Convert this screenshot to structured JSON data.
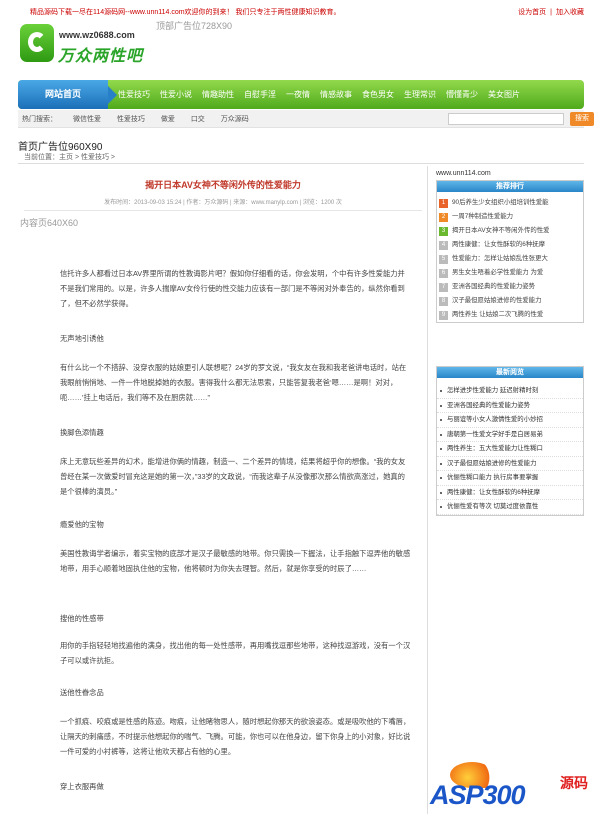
{
  "topbar": {
    "promo": "精品源码下载一尽在114源码网--www.unn114.com欢迎你的到来！ 我们只专注于两性健康知识教育。",
    "set_home": "设为首页",
    "add_favorite": "加入收藏"
  },
  "header_ad": "顶部广告位728X90",
  "logo": {
    "url": "www.wz0688.com",
    "name": "万众两性吧"
  },
  "nav": {
    "home": "网站首页",
    "items": [
      "性爱技巧",
      "性爱小说",
      "情趣助性",
      "自慰手淫",
      "一夜情",
      "情感故事",
      "食色男女",
      "生理常识",
      "懵懂青少",
      "美女图片"
    ]
  },
  "hotbar": {
    "label": "热门搜索：",
    "keywords": [
      "微信性爱",
      "性爱技巧",
      "做爱",
      "口交",
      "万众源码"
    ],
    "search_button": "搜索"
  },
  "banner_ad": "首页广告位960X90",
  "breadcrumb": "当前位置：主页 > 性爱技巧 >",
  "article": {
    "title": "揭开日本AV女神不等闲外传的性爱能力",
    "meta": "发布时间：2013-09-03 15:24 | 作者：万众源码 | 来源：www.manylp.com | 浏览：1200 次",
    "content_ad": "内容页640X60",
    "p1": "信托许多人都看过日本AV界里所谓的性教诲影片吧？假如你仔细看的话，你会发明，个中有许多性爱能力并不是我们常用的。以是，许多人揣摩AV女伶行使的性交能力应该有一部门是不等闲对外奉告的，纵然你看到了，但不必然学获得。",
    "s1": "无声地引诱他",
    "p2": "有什么比一个不措辞、没穿衣服的姑娘更引人联想呢？24岁的罗文说，“我女友在我和我老爸讲电话时，站在我眼前悄悄地、一件一件地脱掉她的衣服。害得我什么都无法思索，只能答复我老爸‘嗯……是啊！对对，呃……’挂上电话后，我们等不及在厨房就……”",
    "s2": "换脚色添情趣",
    "p3": "床上无意玩些差异的幻术，能增进你俩的情趣，制造一、二个差异的情境，结果将超乎你的想像。“我的女友曾经在某一次做爱时冒充这是她的第一次，”33岁的文政说，“而我这辈子从没像那次那么情欲高涨过，她真的是个很棒的演员。”",
    "s3": "瘾爱他的宝物",
    "p4": "美国性教诲学者编示，着实宝物的底部才是汉子最敏感的地带。你只需换一下握法，让手指触下逗弄他的敏感地带，用手心顺着地固执住他的宝物，他将顿时为你失去理智。然后，就是你享受的时辰了……",
    "s4": "搜他的性感带",
    "p5": "用你的手指轻轻地找遍他的满身，找出他的每一处性感带，再用嘴找逗那些地带，这种找逗游戏，没有一个汉子可以或许抗拒。",
    "s5": "送他性眷念品",
    "p6": "一个抓痕、咬痕或是性感的陈迹。吻痕，让他睹物思人，随时想起你那天的欲浪姿态。或是吸吹他的下嘴唇，让隔天的刺痛感，不时提示他想起你的喘气、飞腾。可能，你也可以在他身边，留下你身上的小对象，好比说一件可爱的小衬裤等，这将让他欢天都占有他的心里。",
    "s6": "穿上衣服再做"
  },
  "sidebar": {
    "url": "www.unn114.com",
    "rank_title": "推荐排行",
    "rank": [
      {
        "num": "1",
        "text": "90后养生少女组织小组培训性爱能"
      },
      {
        "num": "2",
        "text": "一周7种制造性爱能力"
      },
      {
        "num": "3",
        "text": "揭开日本AV女神不等闲外传的性爱"
      },
      {
        "num": "4",
        "text": "两性康健：让女性酥软的6种抚摩"
      },
      {
        "num": "5",
        "text": "性爱能力：怎样让姑娘乱性张更大"
      },
      {
        "num": "6",
        "text": "男生女生唔着必学性爱能力 为爱"
      },
      {
        "num": "7",
        "text": "亚洲各国经典的性爱能力姿势"
      },
      {
        "num": "8",
        "text": "汉子最但愿姑娘进修的性爱能力"
      },
      {
        "num": "9",
        "text": "两性养生 让姑娘二次飞腾的性爱"
      }
    ],
    "rec_title": "最新阅览",
    "rec": [
      "怎样进步性爱能力 延迟射精时刻",
      "亚洲各国经典的性爱能力姿势",
      "与丽谊等小女人激情性爱的小妙招",
      "唐朝第一性爱文学好手是白居易弟",
      "两性养生：五大性爱能力让性糊口",
      "汉子最但愿姑娘进修的性爱能力",
      "伉俪性糊口能力 执行房事要掌握",
      "两性康健：让女性酥软的6种抚摩",
      "伉俪性爱有等次 切莫过度依靠性"
    ]
  },
  "watermark": {
    "text": "ASP300",
    "cn": "源码"
  }
}
